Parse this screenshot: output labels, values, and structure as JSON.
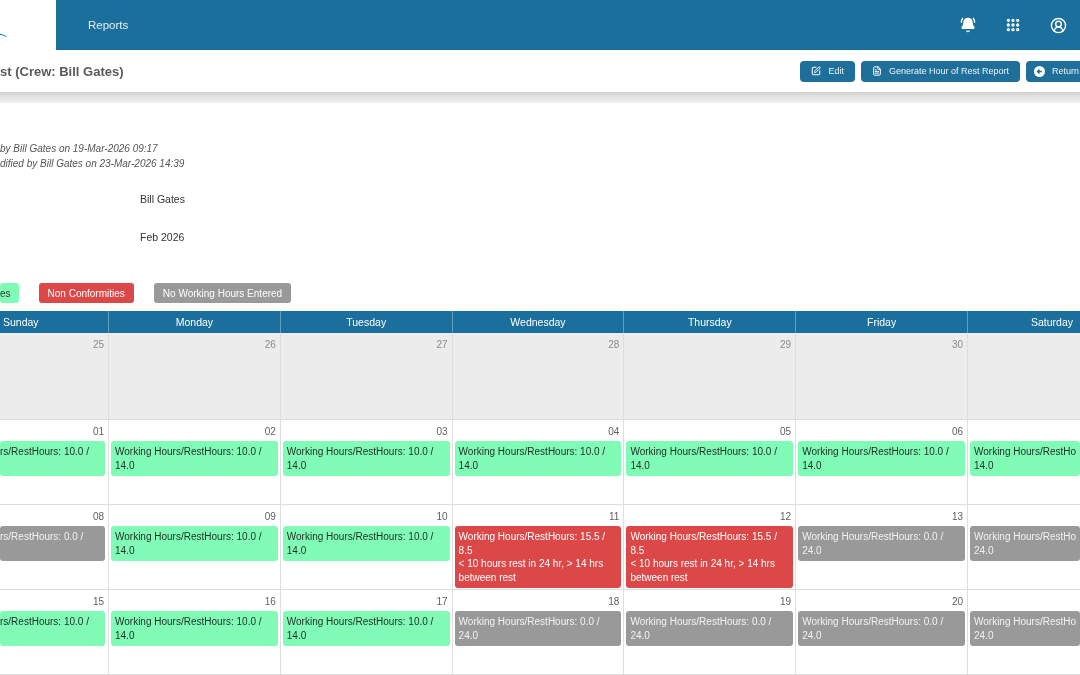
{
  "topbar": {
    "nav": [
      {
        "label": "Reports"
      }
    ]
  },
  "page_header": {
    "title": "st (Crew: Bill Gates)",
    "buttons": [
      {
        "label": "Edit",
        "kind": "edit"
      },
      {
        "label": "Generate Hour of Rest Report",
        "kind": "report"
      },
      {
        "label": "Return",
        "kind": "return"
      }
    ]
  },
  "audit": [
    "by Bill Gates on 19-Mar-2026 09:17",
    "dified by Bill Gates on 23-Mar-2026 14:39"
  ],
  "details": [
    {
      "value": "Bill Gates"
    },
    {
      "value": "Feb 2026"
    }
  ],
  "legend": [
    {
      "label": "es",
      "color": "#80fcb6"
    },
    {
      "label": "Non Conformities",
      "color": "#dc4848"
    },
    {
      "label": "No Working Hours Entered",
      "color": "#999999"
    }
  ],
  "calendar": {
    "weekdays": [
      "Sunday",
      "Monday",
      "Tuesday",
      "Wednesday",
      "Thursday",
      "Friday",
      "Saturday"
    ],
    "weeks": [
      {
        "days": [
          {
            "date": "25",
            "other_month": true
          },
          {
            "date": "26",
            "other_month": true
          },
          {
            "date": "27",
            "other_month": true
          },
          {
            "date": "28",
            "other_month": true
          },
          {
            "date": "29",
            "other_month": true
          },
          {
            "date": "30",
            "other_month": true
          },
          {
            "other_month": true
          }
        ]
      },
      {
        "days": [
          {
            "date": "01",
            "other_month": false,
            "entry": {
              "kind": "ok",
              "text": "rs/RestHours: 10.0 /"
            }
          },
          {
            "date": "02",
            "other_month": false,
            "entry": {
              "kind": "ok",
              "text": "Working Hours/RestHours: 10.0 / 14.0"
            }
          },
          {
            "date": "03",
            "other_month": false,
            "entry": {
              "kind": "ok",
              "text": "Working Hours/RestHours: 10.0 / 14.0"
            }
          },
          {
            "date": "04",
            "other_month": false,
            "entry": {
              "kind": "ok",
              "text": "Working Hours/RestHours: 10.0 / 14.0"
            }
          },
          {
            "date": "05",
            "other_month": false,
            "entry": {
              "kind": "ok",
              "text": "Working Hours/RestHours: 10.0 / 14.0"
            }
          },
          {
            "date": "06",
            "other_month": false,
            "entry": {
              "kind": "ok",
              "text": "Working Hours/RestHours: 10.0 / 14.0"
            }
          },
          {
            "other_month": false,
            "entry": {
              "kind": "ok",
              "text": "Working Hours/RestHo 14.0"
            }
          }
        ]
      },
      {
        "days": [
          {
            "date": "08",
            "other_month": false,
            "entry": {
              "kind": "empty",
              "text": "rs/RestHours: 0.0 /"
            }
          },
          {
            "date": "09",
            "other_month": false,
            "entry": {
              "kind": "ok",
              "text": "Working Hours/RestHours: 10.0 / 14.0"
            }
          },
          {
            "date": "10",
            "other_month": false,
            "entry": {
              "kind": "ok",
              "text": "Working Hours/RestHours: 10.0 / 14.0"
            }
          },
          {
            "date": "11",
            "other_month": false,
            "entry": {
              "kind": "nonconformity",
              "text": "Working Hours/RestHours: 15.5 / 8.5",
              "note": "< 10 hours rest in 24 hr, > 14 hrs between rest"
            }
          },
          {
            "date": "12",
            "other_month": false,
            "entry": {
              "kind": "nonconformity",
              "text": "Working Hours/RestHours: 15.5 / 8.5",
              "note": "< 10 hours rest in 24 hr, > 14 hrs between rest"
            }
          },
          {
            "date": "13",
            "other_month": false,
            "entry": {
              "kind": "empty",
              "text": "Working Hours/RestHours: 0.0 / 24.0"
            }
          },
          {
            "other_month": false,
            "entry": {
              "kind": "empty",
              "text": "Working Hours/RestHo 24.0"
            }
          }
        ]
      },
      {
        "days": [
          {
            "date": "15",
            "other_month": false,
            "entry": {
              "kind": "ok",
              "text": "rs/RestHours: 10.0 /"
            }
          },
          {
            "date": "16",
            "other_month": false,
            "entry": {
              "kind": "ok",
              "text": "Working Hours/RestHours: 10.0 / 14.0"
            }
          },
          {
            "date": "17",
            "other_month": false,
            "entry": {
              "kind": "ok",
              "text": "Working Hours/RestHours: 10.0 / 14.0"
            }
          },
          {
            "date": "18",
            "other_month": false,
            "entry": {
              "kind": "empty",
              "text": "Working Hours/RestHours: 0.0 / 24.0"
            }
          },
          {
            "date": "19",
            "other_month": false,
            "entry": {
              "kind": "empty",
              "text": "Working Hours/RestHours: 0.0 / 24.0"
            }
          },
          {
            "date": "20",
            "other_month": false,
            "entry": {
              "kind": "empty",
              "text": "Working Hours/RestHours: 0.0 / 24.0"
            }
          },
          {
            "other_month": false,
            "entry": {
              "kind": "empty",
              "text": "Working Hours/RestHo 24.0"
            }
          }
        ]
      }
    ]
  }
}
